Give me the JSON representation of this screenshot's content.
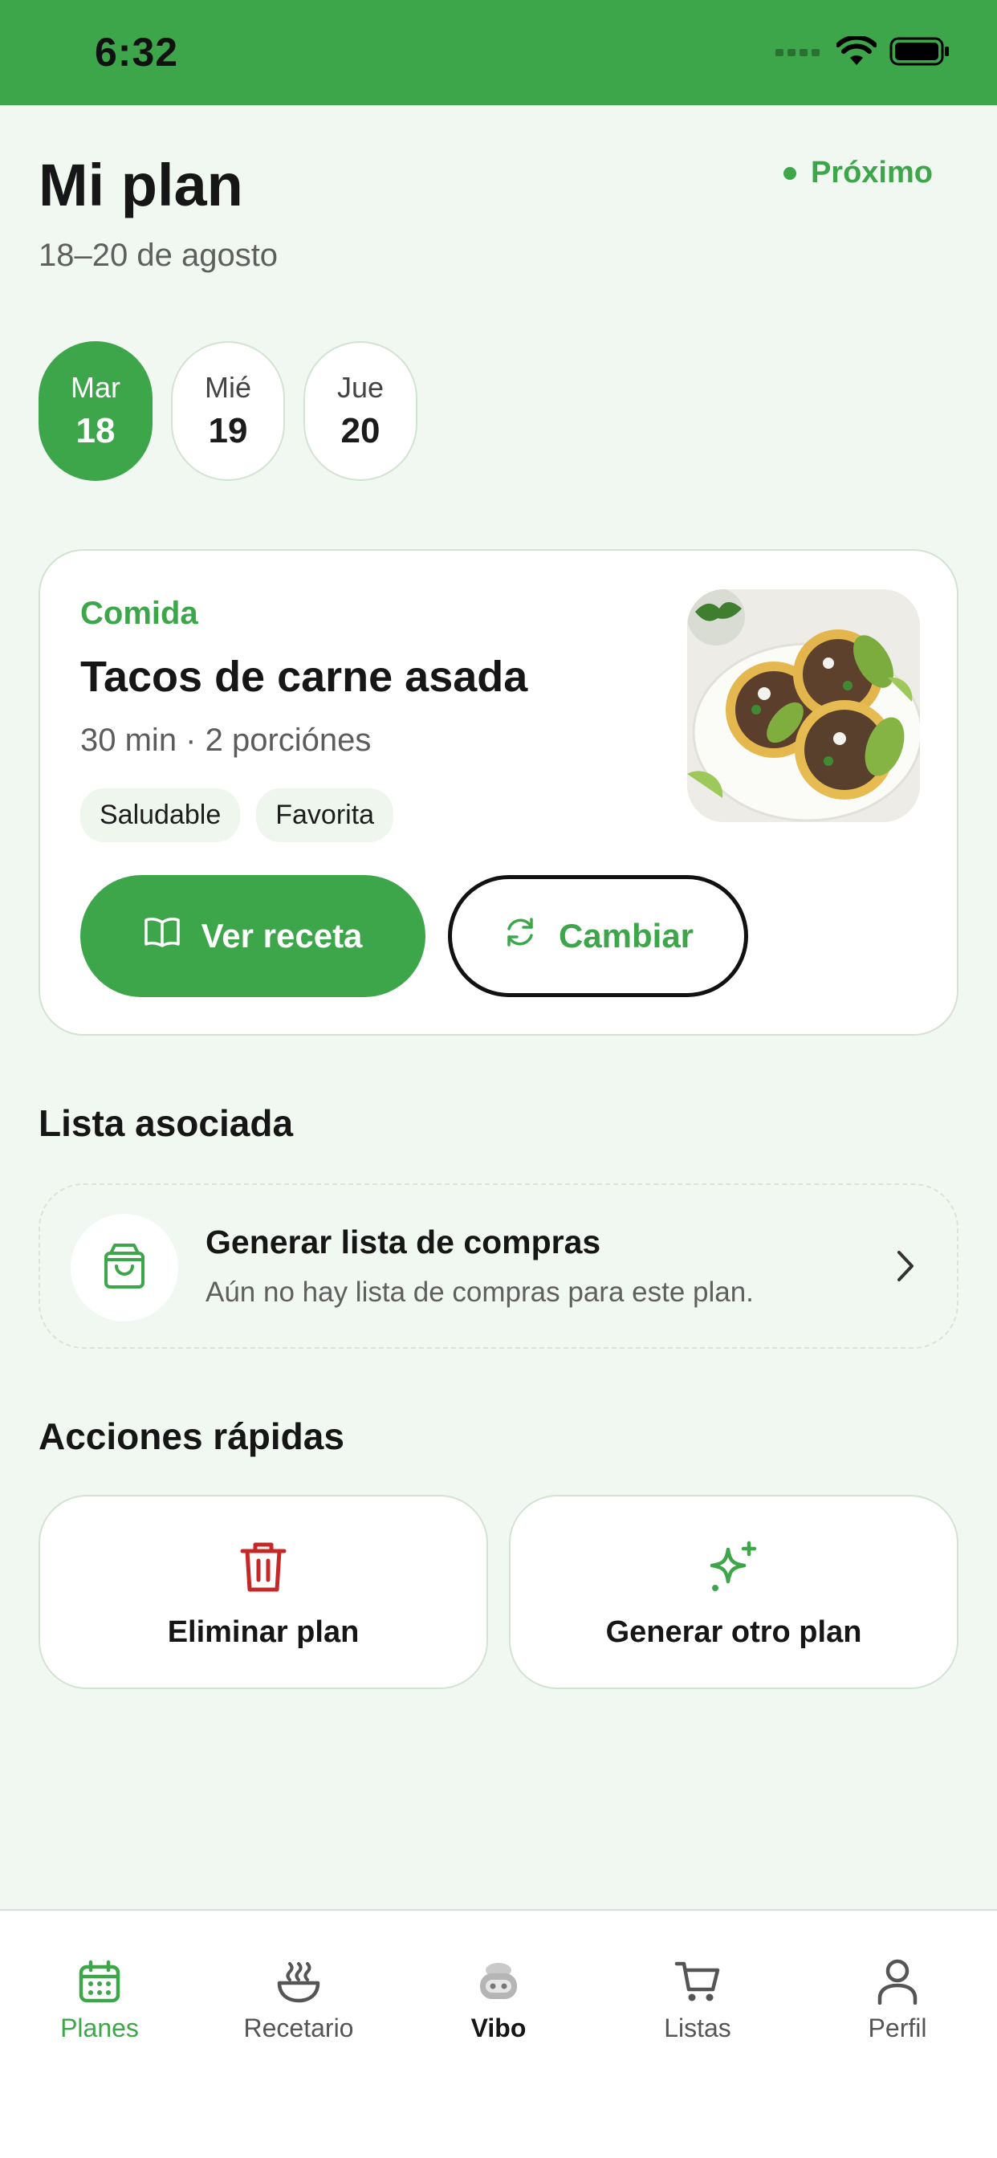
{
  "status_bar": {
    "time": "6:32"
  },
  "header": {
    "title": "Mi plan",
    "date_range": "18–20 de agosto",
    "status": "Próximo"
  },
  "days": [
    {
      "name": "Mar",
      "number": "18",
      "selected": true
    },
    {
      "name": "Mié",
      "number": "19",
      "selected": false
    },
    {
      "name": "Jue",
      "number": "20",
      "selected": false
    }
  ],
  "meal": {
    "type": "Comida",
    "title": "Tacos de carne asada",
    "meta": "30 min · 2 porciónes",
    "tags": [
      "Saludable",
      "Favorita"
    ],
    "view_button": "Ver receta",
    "change_button": "Cambiar"
  },
  "associated_list": {
    "section_title": "Lista asociada",
    "title": "Generar lista de compras",
    "description": "Aún no hay lista de compras para este plan."
  },
  "quick_actions": {
    "section_title": "Acciones rápidas",
    "delete_label": "Eliminar plan",
    "generate_label": "Generar otro plan"
  },
  "tabbar": {
    "items": [
      {
        "label": "Planes",
        "icon": "calendar-icon",
        "active": true
      },
      {
        "label": "Recetario",
        "icon": "bowl-icon"
      },
      {
        "label": "Vibo",
        "icon": "robot-icon"
      },
      {
        "label": "Listas",
        "icon": "cart-icon"
      },
      {
        "label": "Perfil",
        "icon": "user-icon"
      }
    ]
  },
  "colors": {
    "accent": "#3da64a",
    "background": "#f1f8f1",
    "danger": "#c62828"
  }
}
